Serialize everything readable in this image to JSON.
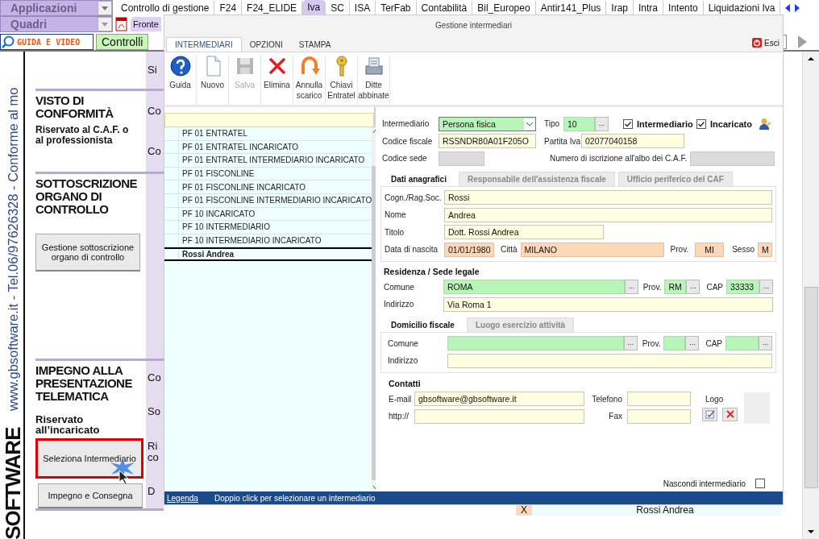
{
  "app_bar": {
    "module_menu": "Applicazioni",
    "section_menu": "Quadri",
    "modules": [
      {
        "label": "Controllo di gestione",
        "selected": false
      },
      {
        "label": "F24",
        "selected": false
      },
      {
        "label": "F24_ELIDE",
        "selected": false
      },
      {
        "label": "Iva",
        "selected": true
      },
      {
        "label": "SC",
        "selected": false
      },
      {
        "label": "ISA",
        "selected": false
      },
      {
        "label": "TerFab",
        "selected": false
      },
      {
        "label": "Contabilità",
        "selected": false
      },
      {
        "label": "Bil_Europeo",
        "selected": false
      },
      {
        "label": "Antir141_Plus",
        "selected": false
      },
      {
        "label": "Irap",
        "selected": false
      },
      {
        "label": "Intra",
        "selected": false
      },
      {
        "label": "Intento",
        "selected": false
      },
      {
        "label": "Liquidazioni Iva",
        "selected": false
      }
    ],
    "sheet_tab": "Fronte",
    "guide_button": "GUIDA E VIDEO",
    "checks_button": "Controlli"
  },
  "side_strip": {
    "contact": "www.gbsoftware.it - Tel.06/97626328 - Conforme al mo",
    "logo": "SOFTWARE"
  },
  "header_fragment": "Si",
  "sections": [
    {
      "title": "VISTO DI CONFORMITÀ",
      "subtitle": "Riservato al C.A.F. o al professionista",
      "fragments": [
        "Co",
        "Co"
      ]
    },
    {
      "title": "SOTTOSCRIZIONE ORGANO DI CONTROLLO",
      "buttons": [
        {
          "label": "Gestione sottoscrizione organo di controllo",
          "highlighted": false
        }
      ]
    },
    {
      "title": "IMPEGNO ALLA PRESENTAZIONE TELEMATICA",
      "subtitle": "Riservato all’incaricato",
      "fragments": [
        "Co",
        "So",
        "Ri co",
        "D"
      ],
      "buttons": [
        {
          "label": "Seleziona Intermediario",
          "highlighted": true
        },
        {
          "label": "Impegno e Consegna",
          "highlighted": false
        }
      ]
    }
  ],
  "background_row": {
    "column_1": "X",
    "column_2": "Rossi Andrea"
  },
  "dialog": {
    "title": "Gestione intermediari",
    "ribbon_tabs": [
      {
        "label": "INTERMEDIARI",
        "selected": true
      },
      {
        "label": "OPZIONI",
        "selected": false
      },
      {
        "label": "STAMPA",
        "selected": false
      }
    ],
    "exit_button": "Esci",
    "toolbar": [
      {
        "label": "Guida",
        "disabled": false
      },
      {
        "label": "Nuovo",
        "disabled": false
      },
      {
        "label": "Salva",
        "disabled": true
      },
      {
        "label": "Elimina",
        "disabled": false
      },
      {
        "label": "Annulla scarico",
        "disabled": false
      },
      {
        "label": "Chiavi Entratel",
        "disabled": false
      },
      {
        "label": "Ditte abbinate",
        "disabled": false
      }
    ],
    "list": [
      {
        "label": "PF 01 ENTRATEL",
        "selected": false
      },
      {
        "label": "PF 01 ENTRATEL INCARICATO",
        "selected": false
      },
      {
        "label": "PF 01 ENTRATEL INTERMEDIARIO INCARICATO",
        "selected": false
      },
      {
        "label": "PF 01 FISCONLINE",
        "selected": false
      },
      {
        "label": "PF 01 FISCONLINE INCARICATO",
        "selected": false
      },
      {
        "label": "PF 01 FISCONLINE INTERMEDIARIO INCARICATO",
        "selected": false
      },
      {
        "label": "PF 10 INCARICATO",
        "selected": false
      },
      {
        "label": "PF 10 INTERMEDIARIO",
        "selected": false
      },
      {
        "label": "PF 10 INTERMEDIARIO INCARICATO",
        "selected": false
      },
      {
        "label": "Rossi Andrea",
        "selected": true
      }
    ],
    "form": {
      "type_field": {
        "label": "Intermediario",
        "value": "Persona fisica",
        "kind": "lookup"
      },
      "tipo": {
        "label": "Tipo",
        "value": "10",
        "kind": "lookup",
        "button": "..."
      },
      "roles": [
        {
          "label": "Intermediario",
          "checked": true
        },
        {
          "label": "Incaricato",
          "checked": true
        }
      ],
      "codice_fiscale": {
        "label": "Codice fiscale",
        "value": "RSSNDR80A01F205O",
        "kind": "text"
      },
      "partita_iva": {
        "label": "Partita Iva",
        "value": "02077040158",
        "kind": "text"
      },
      "codice_sede": {
        "label": "Codice sede",
        "kind": "locked"
      },
      "numero_albo": {
        "label": "Numero di iscrizione all'albo dei C.A.F.",
        "kind": "locked"
      },
      "tabs": [
        {
          "label": "Dati anagrafici",
          "selected": true
        },
        {
          "label": "Responsabile dell'assistenza fiscale",
          "selected": false
        },
        {
          "label": "Ufficio periferico del CAF",
          "selected": false
        }
      ],
      "cognome": {
        "label": "Cogn./Rag.Soc.",
        "value": "Rossi",
        "kind": "text"
      },
      "nome": {
        "label": "Nome",
        "value": "Andrea",
        "kind": "text"
      },
      "titolo": {
        "label": "Titolo",
        "value": "Dott. Rossi Andrea",
        "kind": "text"
      },
      "data_nascita": {
        "label": "Data di nascita",
        "value": "01/01/1980",
        "kind": "birth"
      },
      "citta": {
        "label": "Città",
        "value": "MILANO",
        "kind": "birth"
      },
      "prov_nascita": {
        "label": "Prov.",
        "value": "MI",
        "kind": "birth"
      },
      "sesso": {
        "label": "Sesso",
        "value": "M",
        "kind": "birth"
      },
      "residenza": {
        "title": "Residenza / Sede legale",
        "comune": {
          "label": "Comune",
          "value": "ROMA",
          "kind": "lookup",
          "button": "..."
        },
        "prov": {
          "label": "Prov.",
          "value": "RM",
          "kind": "lookup",
          "button": "..."
        },
        "cap": {
          "label": "CAP",
          "value": "33333",
          "kind": "lookup",
          "button": "..."
        },
        "indirizzo": {
          "label": "Indirizzo",
          "value": "Via Roma 1",
          "kind": "text"
        }
      },
      "domicilio_tabs": [
        {
          "label": "Domicilio fiscale",
          "selected": true
        },
        {
          "label": "Luogo esercizio attività",
          "selected": false
        }
      ],
      "domicilio": {
        "comune": {
          "label": "Comune",
          "kind": "lookup",
          "button": "..."
        },
        "prov": {
          "label": "Prov.",
          "kind": "lookup",
          "button": "..."
        },
        "cap": {
          "label": "CAP",
          "kind": "lookup",
          "button": "..."
        },
        "indirizzo": {
          "label": "Indirizzo",
          "kind": "text"
        }
      },
      "contatti": {
        "title": "Contatti",
        "email": {
          "label": "E-mail",
          "value": "gbsoftware@gbsoftware.it",
          "kind": "text"
        },
        "telefono": {
          "label": "Telefono",
          "kind": "text"
        },
        "web": {
          "label": "http://",
          "kind": "text"
        },
        "fax": {
          "label": "Fax",
          "kind": "text"
        },
        "logo": "Logo"
      },
      "hide_option": {
        "label": "Nascondi intermediario",
        "checked": false
      }
    },
    "status_bar": {
      "link": "Legenda",
      "hint": "Doppio click per selezionare un intermediario"
    }
  }
}
